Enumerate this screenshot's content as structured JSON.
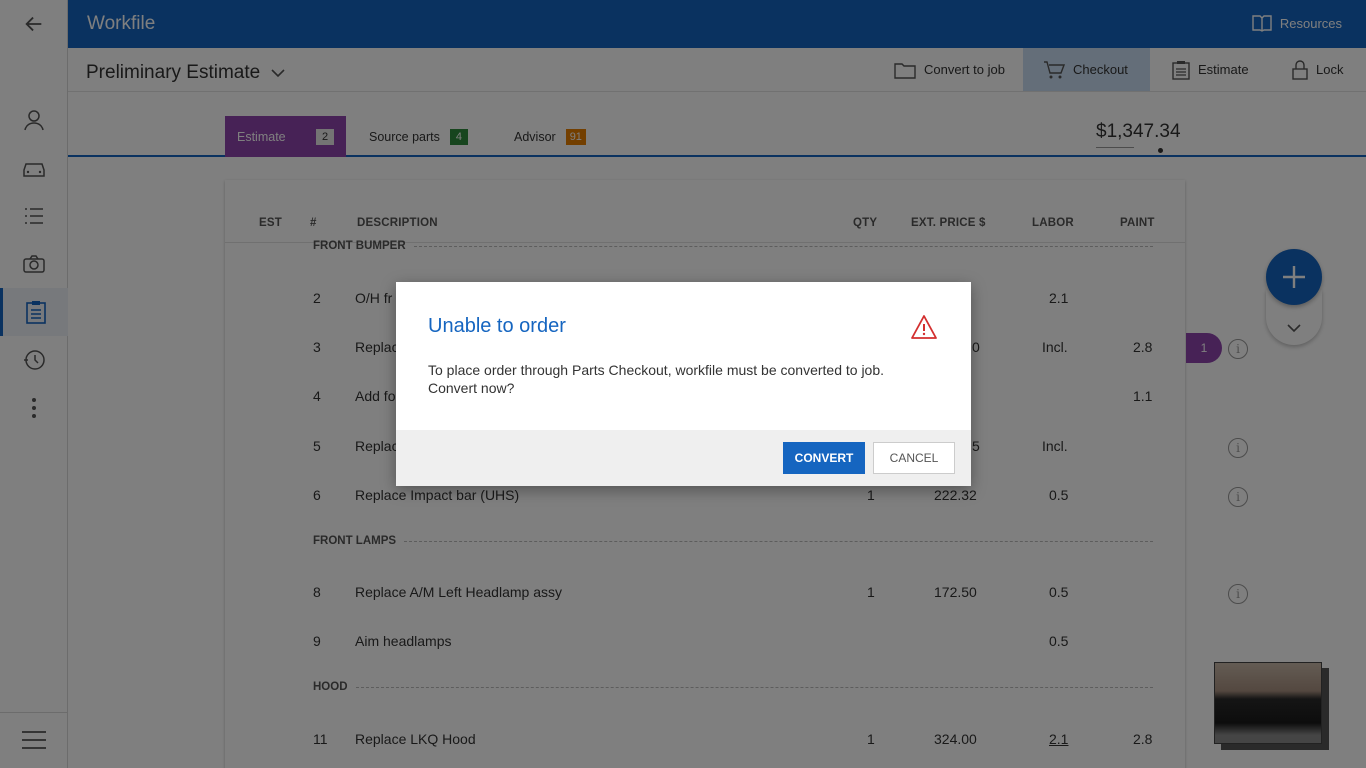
{
  "app": {
    "title": "Workfile",
    "resources_label": "Resources"
  },
  "subheader": {
    "title": "Preliminary Estimate",
    "actions": {
      "convert_to_job": "Convert to job",
      "checkout": "Checkout",
      "estimate": "Estimate",
      "lock": "Lock"
    }
  },
  "tabs": [
    {
      "label": "Estimate",
      "badge": "2"
    },
    {
      "label": "Source parts",
      "badge": "4"
    },
    {
      "label": "Advisor",
      "badge": "91"
    }
  ],
  "total": "$1,347.34",
  "table": {
    "headers": {
      "est": "EST",
      "num": "#",
      "description": "DESCRIPTION",
      "qty": "QTY",
      "ext_price": "EXT. PRICE $",
      "labor": "LABOR",
      "paint": "PAINT"
    },
    "sections": [
      "FRONT BUMPER",
      "FRONT LAMPS",
      "HOOD"
    ],
    "rows": [
      {
        "num": "2",
        "description": "O/H fr",
        "qty": "",
        "price": "",
        "labor": "2.1",
        "paint": ""
      },
      {
        "num": "3",
        "description": "Replac",
        "qty": "",
        "price": "0",
        "labor": "Incl.",
        "paint": "2.8"
      },
      {
        "num": "4",
        "description": "Add fo",
        "qty": "",
        "price": "",
        "labor": "",
        "paint": "1.1"
      },
      {
        "num": "5",
        "description": "Replac",
        "qty": "",
        "price": "5",
        "labor": "Incl.",
        "paint": ""
      },
      {
        "num": "6",
        "description": "Replace Impact bar (UHS)",
        "qty": "1",
        "price": "222.32",
        "labor": "0.5",
        "paint": ""
      },
      {
        "num": "8",
        "description": "Replace A/M Left Headlamp assy",
        "qty": "1",
        "price": "172.50",
        "labor": "0.5",
        "paint": ""
      },
      {
        "num": "9",
        "description": "Aim headlamps",
        "qty": "",
        "price": "",
        "labor": "0.5",
        "paint": ""
      },
      {
        "num": "11",
        "description": "Replace LKQ Hood",
        "qty": "1",
        "price": "324.00",
        "labor": "2.1",
        "paint": "2.8"
      }
    ]
  },
  "side_pill": "1",
  "modal": {
    "title": "Unable to order",
    "body": "To place order through Parts Checkout, workfile must be converted to job. Convert now?",
    "convert_label": "CONVERT",
    "cancel_label": "CANCEL"
  },
  "colors": {
    "brand_blue": "#1565c0",
    "estimate_purple": "#8e44ad",
    "warning_red": "#d32f2f"
  }
}
